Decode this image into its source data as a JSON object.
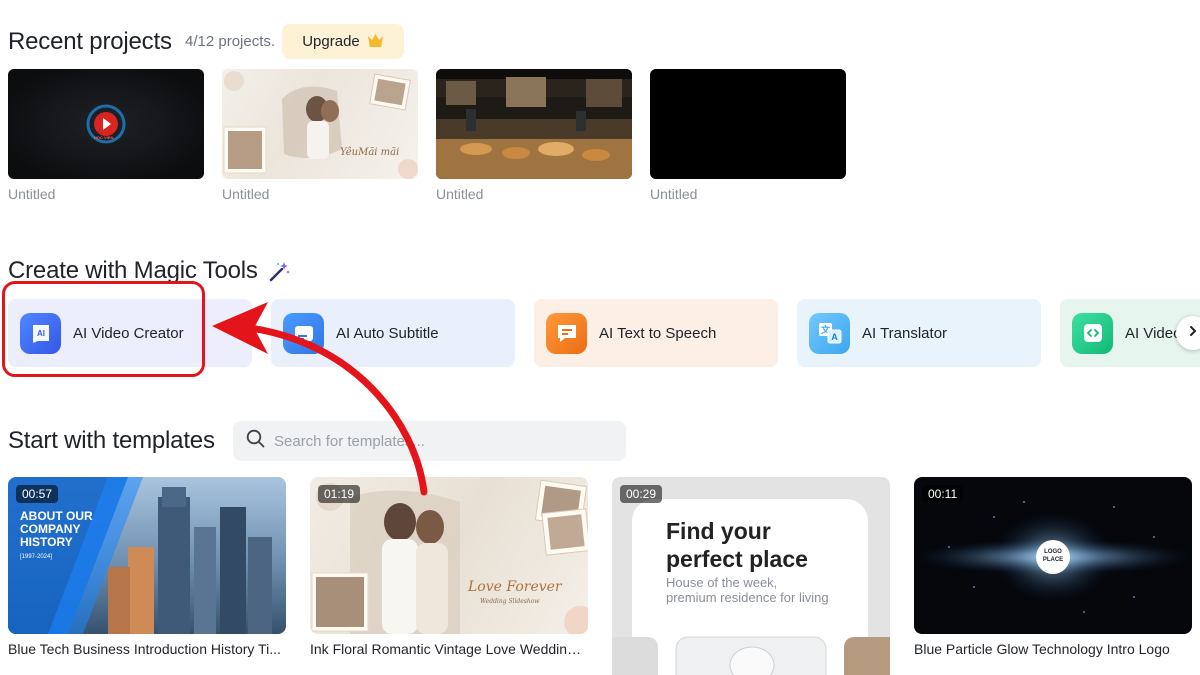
{
  "recent": {
    "title": "Recent projects",
    "count": "4/12 projects.",
    "upgrade_label": "Upgrade",
    "projects": [
      {
        "label": "Untitled",
        "logo_text": "HOC VIEN"
      },
      {
        "label": "Untitled",
        "overlay_text": "YêuMãi mãi"
      },
      {
        "label": "Untitled"
      },
      {
        "label": "Untitled"
      }
    ]
  },
  "magic": {
    "title": "Create with Magic Tools",
    "tools": [
      {
        "label": "AI Video Creator",
        "icon": "ai-video-icon",
        "bg": "#eceefb",
        "icon_bg": "#3d6cf0",
        "icon_text": "AI"
      },
      {
        "label": "AI Auto Subtitle",
        "icon": "subtitle-icon",
        "bg": "#e9f0fb",
        "icon_bg": "#3d86f0"
      },
      {
        "label": "AI Text to Speech",
        "icon": "speech-bubble-icon",
        "bg": "#fcf0e6",
        "icon_bg": "#f07c1e"
      },
      {
        "label": "AI Translator",
        "icon": "translate-icon",
        "bg": "#e8f3fb",
        "icon_bg": "#52b6f0"
      },
      {
        "label": "AI Video",
        "icon": "code-icon",
        "bg": "#e6f6ef",
        "icon_bg": "#20c483"
      }
    ]
  },
  "templates": {
    "title": "Start with templates",
    "search_placeholder": "Search for templates...",
    "items": [
      {
        "duration": "00:57",
        "name": "Blue Tech Business Introduction History Ti...",
        "overlay": [
          "ABOUT OUR",
          "COMPANY",
          "HISTORY"
        ],
        "overlay_small": "[1997-2024]"
      },
      {
        "duration": "01:19",
        "name": "Ink Floral Romantic Vintage Love Wedding A...",
        "overlay": "Love Forever",
        "overlay_small": "Wedding Slideshow"
      },
      {
        "duration": "00:29",
        "name": "",
        "heading_1": "Find your",
        "heading_2": "perfect place",
        "sub_1": "House of the week,",
        "sub_2": "premium residence for living"
      },
      {
        "duration": "00:11",
        "name": "Blue Particle Glow Technology Intro Logo",
        "logo_1": "LOGO",
        "logo_2": "PLACE"
      }
    ]
  },
  "colors": {
    "accent_red": "#e3151a",
    "upgrade_bg": "#fdf1d6",
    "crown": "#f5b82e"
  }
}
